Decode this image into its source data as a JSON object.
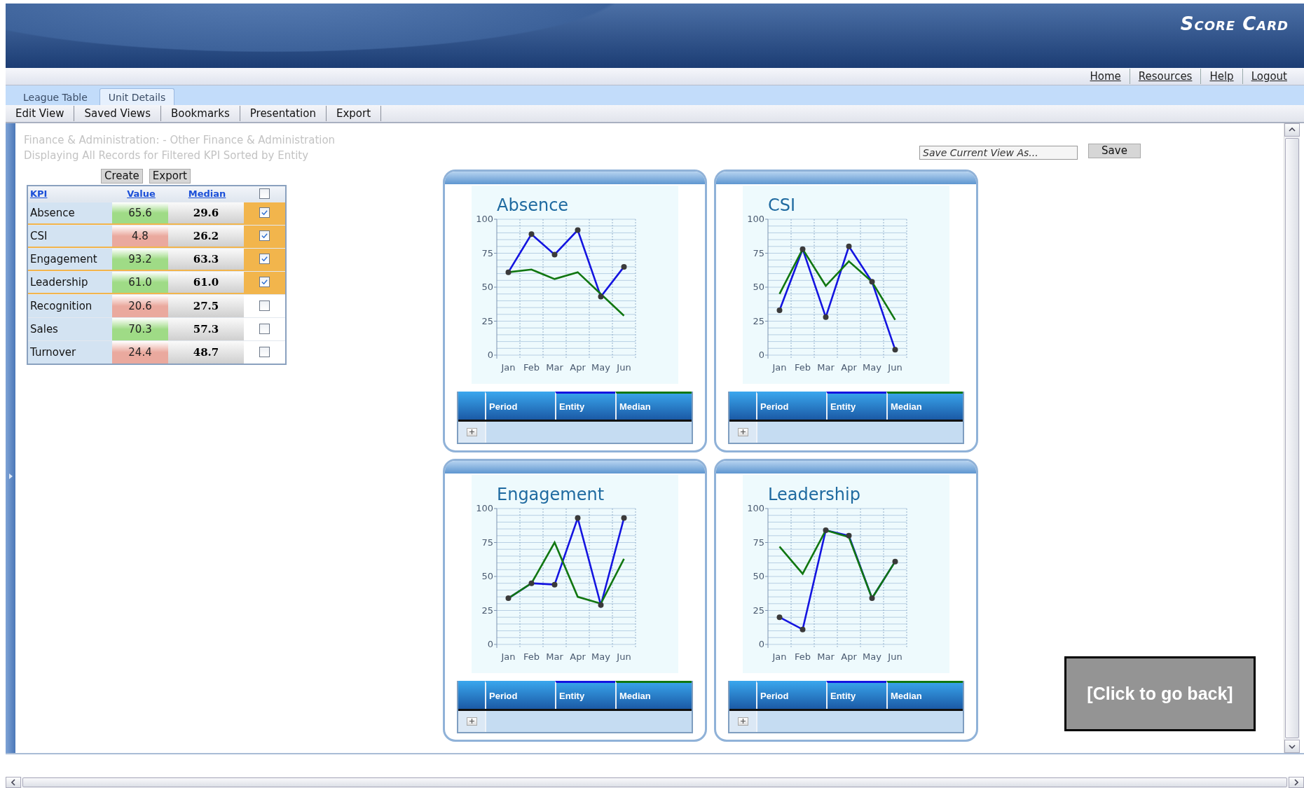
{
  "header": {
    "title": "Score Card"
  },
  "nav_links": [
    "Home",
    "Resources",
    "Help",
    "Logout"
  ],
  "tabs": [
    {
      "label": "League Table",
      "selected": false
    },
    {
      "label": "Unit Details",
      "selected": true
    }
  ],
  "toolbar": [
    "Edit View",
    "Saved Views",
    "Bookmarks",
    "Presentation",
    "Export"
  ],
  "subtitle_lines": [
    "Finance & Administration: - Other Finance & Administration",
    "Displaying All Records for Filtered KPI Sorted by Entity"
  ],
  "table_buttons": [
    "Create",
    "Export"
  ],
  "kpi_table": {
    "columns": [
      "KPI",
      "Value",
      "Median"
    ],
    "select_all_checked": false,
    "rows": [
      {
        "kpi": "Absence",
        "value": "65.6",
        "color": "#9fdb86",
        "median": "29.6",
        "checked": true
      },
      {
        "kpi": "CSI",
        "value": "4.8",
        "color": "#eaa99e",
        "median": "26.2",
        "checked": true
      },
      {
        "kpi": "Engagement",
        "value": "93.2",
        "color": "#9fdb86",
        "median": "63.3",
        "checked": true
      },
      {
        "kpi": "Leadership",
        "value": "61.0",
        "color": "#9fdb86",
        "median": "61.0",
        "checked": true
      },
      {
        "kpi": "Recognition",
        "value": "20.6",
        "color": "#eaa99e",
        "median": "27.5",
        "checked": false
      },
      {
        "kpi": "Sales",
        "value": "70.3",
        "color": "#9fdb86",
        "median": "57.3",
        "checked": false
      },
      {
        "kpi": "Turnover",
        "value": "24.4",
        "color": "#eaa99e",
        "median": "48.7",
        "checked": false
      }
    ]
  },
  "save_view": {
    "placeholder": "Save Current View As...",
    "button": "Save"
  },
  "charts": [
    {
      "chart_data": {
        "type": "line",
        "title": "Absence",
        "categories": [
          "Jan",
          "Feb",
          "Mar",
          "Apr",
          "May",
          "Jun"
        ],
        "ylim": [
          0,
          100
        ],
        "yticks": [
          0,
          25,
          50,
          75,
          100
        ],
        "grid": true,
        "series": [
          {
            "name": "Entity",
            "color": "#1414e0",
            "marker": "circle",
            "values": [
              61,
              89,
              74,
              92,
              43,
              65
            ]
          },
          {
            "name": "Median",
            "color": "#117711",
            "values": [
              61,
              63,
              56,
              61,
              45,
              29
            ]
          }
        ]
      },
      "legend_first_column": "Period"
    },
    {
      "chart_data": {
        "type": "line",
        "title": "CSI",
        "categories": [
          "Jan",
          "Feb",
          "Mar",
          "Apr",
          "May",
          "Jun"
        ],
        "ylim": [
          0,
          100
        ],
        "yticks": [
          0,
          25,
          50,
          75,
          100
        ],
        "grid": true,
        "series": [
          {
            "name": "Entity",
            "color": "#1414e0",
            "marker": "circle",
            "values": [
              33,
              78,
              28,
              80,
              54,
              4
            ]
          },
          {
            "name": "Median",
            "color": "#117711",
            "values": [
              45,
              78,
              51,
              69,
              54,
              26
            ]
          }
        ]
      },
      "legend_first_column": "Period"
    },
    {
      "chart_data": {
        "type": "line",
        "title": "Engagement",
        "categories": [
          "Jan",
          "Feb",
          "Mar",
          "Apr",
          "May",
          "Jun"
        ],
        "ylim": [
          0,
          100
        ],
        "yticks": [
          0,
          25,
          50,
          75,
          100
        ],
        "grid": true,
        "series": [
          {
            "name": "Entity",
            "color": "#1414e0",
            "marker": "circle",
            "values": [
              34,
              45,
              44,
              93,
              29,
              93
            ]
          },
          {
            "name": "Median",
            "color": "#117711",
            "values": [
              34,
              45,
              75,
              35,
              30,
              63
            ]
          }
        ]
      },
      "legend_first_column": "Period"
    },
    {
      "chart_data": {
        "type": "line",
        "title": "Leadership",
        "categories": [
          "Jan",
          "Feb",
          "Mar",
          "Apr",
          "May",
          "Jun"
        ],
        "ylim": [
          0,
          100
        ],
        "yticks": [
          0,
          25,
          50,
          75,
          100
        ],
        "grid": true,
        "series": [
          {
            "name": "Entity",
            "color": "#1414e0",
            "marker": "circle",
            "values": [
              20,
              11,
              84,
              80,
              34,
              61
            ]
          },
          {
            "name": "Median",
            "color": "#117711",
            "values": [
              72,
              52,
              84,
              79,
              34,
              61
            ]
          }
        ]
      },
      "legend_first_column": "Period"
    }
  ],
  "back_button": "[Click to go back]"
}
